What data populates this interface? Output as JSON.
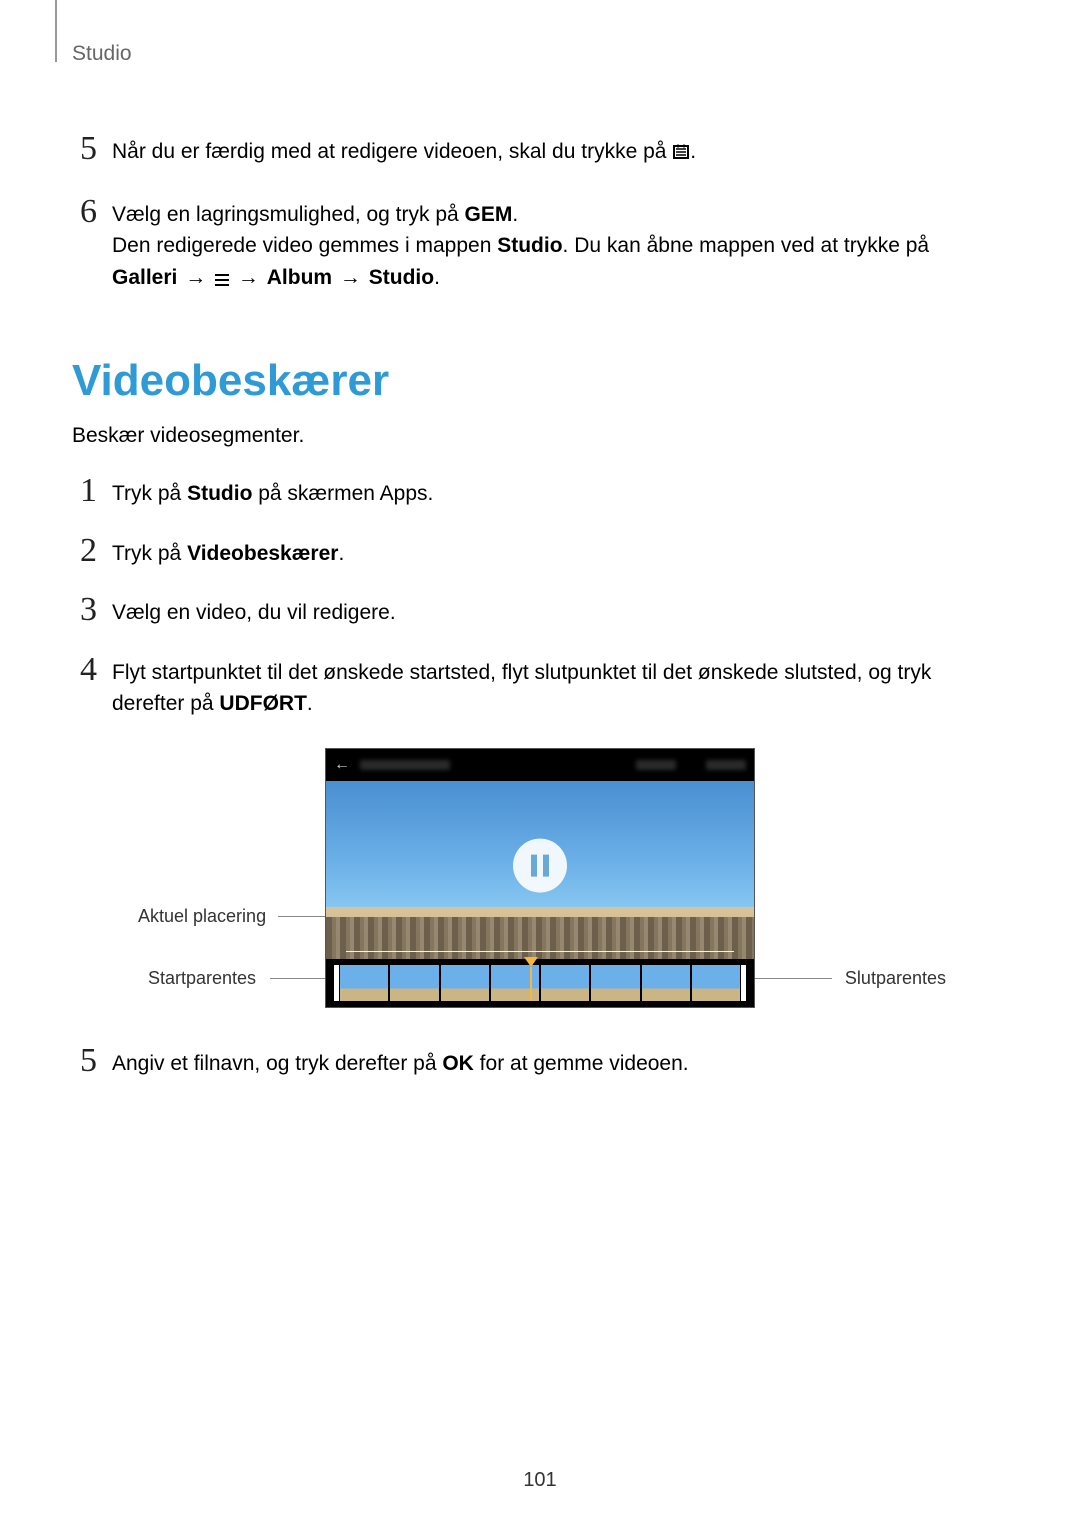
{
  "header": {
    "section": "Studio"
  },
  "steps_top": [
    {
      "num": "5",
      "pre": "Når du er færdig med at redigere videoen, skal du trykke på ",
      "post": "."
    },
    {
      "num": "6",
      "line1_a": "Vælg en lagringsmulighed, og tryk på ",
      "line1_b_bold": "GEM",
      "line1_c": ".",
      "line2_a": "Den redigerede video gemmes i mappen ",
      "line2_b_bold": "Studio",
      "line2_c": ". Du kan åbne mappen ved at trykke på ",
      "line3_a_bold": "Galleri",
      "line3_arrow1": "→",
      "line3_arrow2": "→",
      "line3_b_bold": "Album",
      "line3_arrow3": "→",
      "line3_c_bold": "Studio",
      "line3_d": "."
    }
  ],
  "section_heading": "Videobeskærer",
  "intro": "Beskær videosegmenter.",
  "steps_main": [
    {
      "num": "1",
      "a": "Tryk på ",
      "b_bold": "Studio",
      "c": " på skærmen Apps."
    },
    {
      "num": "2",
      "a": "Tryk på ",
      "b_bold": "Videobeskærer",
      "c": "."
    },
    {
      "num": "3",
      "a": "Vælg en video, du vil redigere."
    },
    {
      "num": "4",
      "a": "Flyt startpunktet til det ønskede startsted, flyt slutpunktet til det ønskede slutsted, og tryk derefter på ",
      "b_bold": "UDFØRT",
      "c": "."
    }
  ],
  "callouts": {
    "current": "Aktuel placering",
    "start": "Startparentes",
    "end": "Slutparentes"
  },
  "step5": {
    "num": "5",
    "a": "Angiv et filnavn, og tryk derefter på ",
    "b_bold": "OK",
    "c": " for at gemme videoen."
  },
  "page_number": "101"
}
